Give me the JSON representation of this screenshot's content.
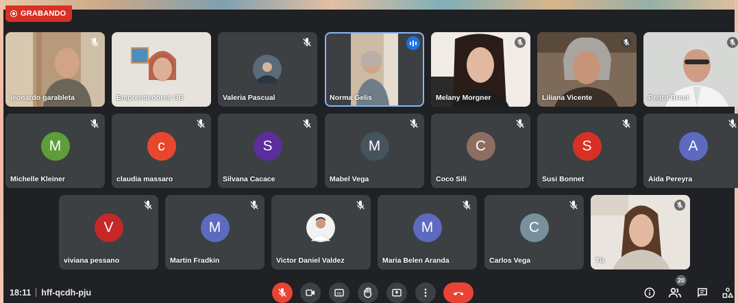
{
  "recording": {
    "label": "GRABANDO"
  },
  "row1": [
    {
      "name": "leonardo garableta",
      "type": "photo"
    },
    {
      "name": "Emprendedores UB",
      "type": "photo"
    },
    {
      "name": "Valeria Pascual",
      "type": "small-photo"
    },
    {
      "name": "Norma Gelis",
      "type": "photo",
      "speaking": true
    },
    {
      "name": "Melany Morgner",
      "type": "photo"
    },
    {
      "name": "Liliana Vicente",
      "type": "photo"
    },
    {
      "name": "Pedro Brest",
      "type": "photo"
    }
  ],
  "row2": [
    {
      "name": "Michelle Kleiner",
      "initial": "M",
      "color": "#5e9e3a"
    },
    {
      "name": "claudia massaro",
      "initial": "c",
      "color": "#e8472f"
    },
    {
      "name": "Silvana Cacace",
      "initial": "S",
      "color": "#5c2d9c"
    },
    {
      "name": "Mabel Vega",
      "initial": "M",
      "color": "#44535c"
    },
    {
      "name": "Coco Sili",
      "initial": "C",
      "color": "#8d6e63"
    },
    {
      "name": "Susi Bonnet",
      "initial": "S",
      "color": "#d93025"
    },
    {
      "name": "Aida Pereyra",
      "initial": "A",
      "color": "#5c6bc0"
    }
  ],
  "row3": [
    {
      "name": "viviana pessano",
      "initial": "V",
      "color": "#c62828"
    },
    {
      "name": "Martin Fradkin",
      "initial": "M",
      "color": "#5c6bc0"
    },
    {
      "name": "Victor Daniel Valdez",
      "type": "small-photo"
    },
    {
      "name": "Maria Belen Aranda",
      "initial": "M",
      "color": "#5c6bc0"
    },
    {
      "name": "Carlos Vega",
      "initial": "C",
      "color": "#78909c"
    },
    {
      "name": "Tú",
      "type": "photo"
    }
  ],
  "bottom": {
    "time": "18:11",
    "meeting_code": "hff-qcdh-pju",
    "participants_count": "20"
  },
  "icons": {
    "record": "record-icon",
    "mic_off": "mic-off-icon",
    "camera": "camera-icon",
    "captions": "captions-icon",
    "raise_hand": "hand-icon",
    "present": "present-icon",
    "more": "more-vert-icon",
    "hang_up": "call-end-icon",
    "info": "info-icon",
    "people": "people-icon",
    "chat": "chat-icon",
    "activities": "activities-icon"
  }
}
